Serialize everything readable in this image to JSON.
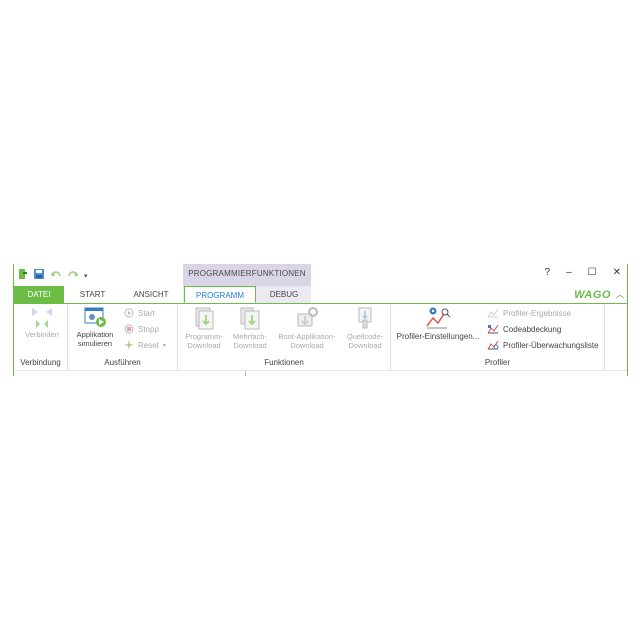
{
  "quick_access": {
    "icons": [
      "green-app-icon",
      "save-icon",
      "undo-icon",
      "redo-icon",
      "customize-icon"
    ]
  },
  "context_header": "PROGRAMMIERFUNKTIONEN",
  "window_controls": {
    "help": "?",
    "minimize": "–",
    "maximize": "☐",
    "close": "✕"
  },
  "tabs": [
    "DATEI",
    "START",
    "ANSICHT",
    "PROGRAMM",
    "DEBUG"
  ],
  "active_tab": "PROGRAMM",
  "logo": "WAGO",
  "groups": {
    "verbindung": {
      "label": "Verbindung",
      "connect": "Verbinden"
    },
    "ausfuehren": {
      "label": "Ausführen",
      "simulate": "Applikation simulieren",
      "start": "Start",
      "stop": "Stopp",
      "reset": "Reset"
    },
    "funktionen": {
      "label": "Funktionen",
      "program_download": "Programm-Download",
      "multi_download": "Mehrfach-Download",
      "boot_download": "Boot-Applikation-Download",
      "source_download": "Quellcode-Download"
    },
    "profiler": {
      "label": "Profiler",
      "settings": "Profiler-Einstellungen...",
      "results": "Profiler-Ergebnisse",
      "coverage": "Codeabdeckung",
      "watchlist": "Profiler-Überwachungsliste"
    }
  },
  "colors": {
    "accent": "#6cbd45",
    "context": "#d9d4e6",
    "active_text": "#2a7bd6"
  }
}
